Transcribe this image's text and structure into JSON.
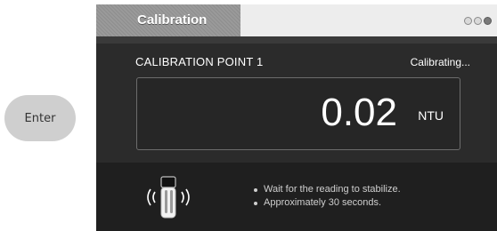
{
  "enter_button": {
    "label": "Enter"
  },
  "window": {
    "title": "Calibration",
    "controls": [
      "minimize-icon",
      "maximize-icon",
      "close-icon"
    ]
  },
  "calibration": {
    "point_label": "CALIBRATION POINT  1",
    "status": "Calibrating...",
    "reading_value": "0.02",
    "reading_unit": "NTU"
  },
  "instructions": [
    "Wait for the reading to stabilize.",
    "Approximately 30 seconds."
  ],
  "icons": {
    "vial": "vial-reading-icon"
  },
  "colors": {
    "window_bg": "#2b2b2b",
    "bottom_panel_bg": "#1f1f1f",
    "title_tab": "#939393",
    "enter_button_bg": "#cfcfcf"
  }
}
